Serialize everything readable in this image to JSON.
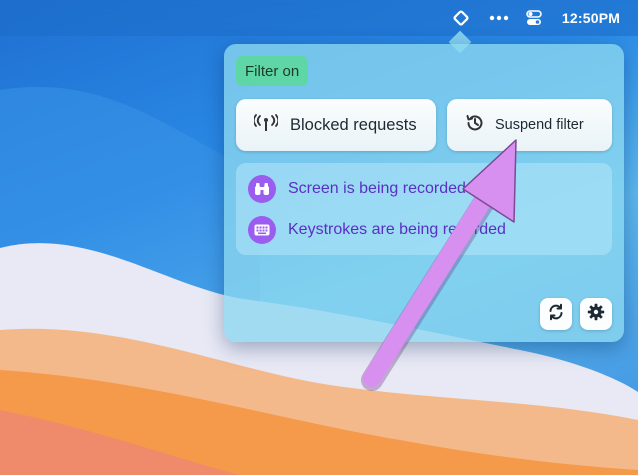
{
  "menubar": {
    "filter_icon": "filter-diamond-icon",
    "more_icon": "more-dots-icon",
    "control_icon": "control-center-icon",
    "clock": "12:50PM"
  },
  "popup": {
    "status_badge": "Filter on",
    "blocked_button": {
      "label": "Blocked requests",
      "icon": "antenna-icon"
    },
    "suspend_button": {
      "label": "Suspend filter",
      "icon": "history-icon"
    },
    "alerts": [
      {
        "text": "Screen is being recorded",
        "icon": "binoculars-icon"
      },
      {
        "text": "Keystrokes are being recorded",
        "icon": "keyboard-icon"
      }
    ],
    "footer": {
      "refresh_icon": "refresh-icon",
      "settings_icon": "gear-icon"
    }
  },
  "colors": {
    "badge_bg": "#5fd6a6",
    "alert_icon_bg": "#9b5cf0",
    "alert_text": "#5a2fc4",
    "annotation_arrow": "#d890f0"
  }
}
